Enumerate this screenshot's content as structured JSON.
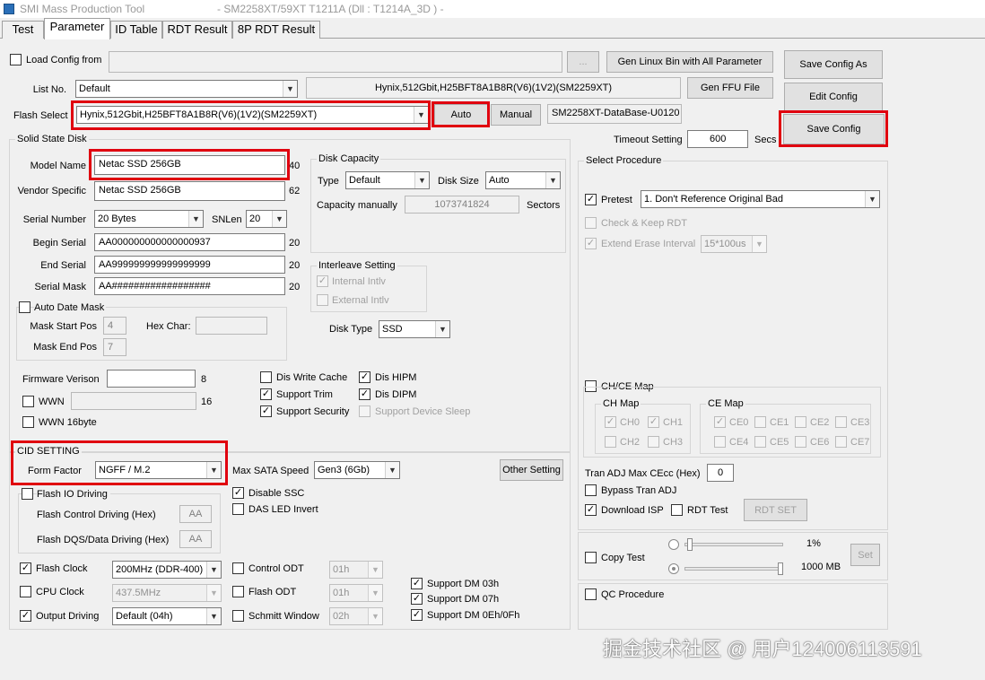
{
  "window": {
    "title": "SMI Mass Production Tool",
    "subtitle": "- SM2258XT/59XT   T1211A     (Dll : T1214A_3D ) -"
  },
  "tabs": [
    "Test",
    "Parameter",
    "ID Table",
    "RDT Result",
    "8P RDT Result"
  ],
  "top": {
    "load_config_label": "Load Config from",
    "load_config_checked": false,
    "load_config_path": "",
    "browse_label": "...",
    "gen_linux_label": "Gen Linux Bin with All Parameter",
    "gen_ffu_label": "Gen FFU File",
    "save_config_as_label": "Save Config As",
    "edit_config_label": "Edit Config",
    "save_config_label": "Save Config",
    "list_no_label": "List No.",
    "list_no_value": "Default",
    "flash_info": "Hynix,512Gbit,H25BFT8A1B8R(V6)(1V2)(SM2259XT)",
    "flash_select_label": "Flash Select",
    "flash_select_value": "Hynix,512Gbit,H25BFT8A1B8R(V6)(1V2)(SM2259XT)",
    "auto_label": "Auto",
    "manual_label": "Manual",
    "database": "SM2258XT-DataBase-U0120",
    "timeout_label": "Timeout Setting",
    "timeout_value": "600",
    "timeout_unit": "Secs"
  },
  "ssd": {
    "group_label": "Solid State Disk",
    "model_name_label": "Model Name",
    "model_name_value": "Netac SSD 256GB",
    "model_name_len": "40",
    "vendor_label": "Vendor Specific",
    "vendor_value": "Netac SSD 256GB",
    "vendor_len": "62",
    "serial_number_label": "Serial Number",
    "serial_number_value": "20 Bytes",
    "snlen_label": "SNLen",
    "snlen_value": "20",
    "begin_serial_label": "Begin Serial",
    "begin_serial_value": "AA000000000000000937",
    "begin_serial_len": "20",
    "end_serial_label": "End Serial",
    "end_serial_value": "AA999999999999999999",
    "end_serial_len": "20",
    "serial_mask_label": "Serial Mask",
    "serial_mask_value": "AA##################",
    "serial_mask_len": "20",
    "auto_date_mask_label": "Auto Date Mask",
    "auto_date_mask_checked": false,
    "mask_start_label": "Mask Start Pos",
    "mask_start_value": "4",
    "hex_char_label": "Hex Char:",
    "hex_char_value": "",
    "mask_end_label": "Mask End Pos",
    "mask_end_value": "7",
    "disk_capacity_label": "Disk Capacity",
    "type_label": "Type",
    "type_value": "Default",
    "disk_size_label": "Disk Size",
    "disk_size_value": "Auto",
    "capacity_manually_label": "Capacity manually",
    "capacity_value": "1073741824",
    "sectors_label": "Sectors",
    "interleave_label": "Interleave Setting",
    "internal_intlv_label": "Internal Intlv",
    "internal_intlv_checked": true,
    "external_intlv_label": "External Intlv",
    "external_intlv_checked": false,
    "disk_type_label": "Disk Type",
    "disk_type_value": "SSD",
    "firmware_label": "Firmware Verison",
    "firmware_value": "",
    "firmware_len": "8",
    "wwn_label": "WWN",
    "wwn_checked": false,
    "wwn_value": "",
    "wwn_len": "16",
    "wwn16_label": "WWN 16byte",
    "wwn16_checked": false,
    "dis_write_cache_label": "Dis Write Cache",
    "dis_write_cache_checked": false,
    "dis_hipm_label": "Dis HIPM",
    "dis_hipm_checked": true,
    "support_trim_label": "Support Trim",
    "support_trim_checked": true,
    "dis_dipm_label": "Dis DIPM",
    "dis_dipm_checked": true,
    "support_security_label": "Support Security",
    "support_security_checked": true,
    "support_device_sleep_label": "Support Device Sleep",
    "support_device_sleep_checked": false
  },
  "cid": {
    "group_label": "CID SETTING",
    "form_factor_label": "Form Factor",
    "form_factor_value": "NGFF / M.2",
    "max_sata_label": "Max SATA Speed",
    "max_sata_value": "Gen3 (6Gb)",
    "other_setting_label": "Other Setting",
    "flash_io_label": "Flash IO Driving",
    "flash_io_checked": false,
    "flash_control_label": "Flash Control Driving (Hex)",
    "flash_control_value": "AA",
    "flash_dqs_label": "Flash DQS/Data Driving (Hex)",
    "flash_dqs_value": "AA",
    "disable_ssc_label": "Disable SSC",
    "disable_ssc_checked": true,
    "das_led_label": "DAS LED Invert",
    "das_led_checked": false,
    "flash_clock_label": "Flash Clock",
    "flash_clock_checked": true,
    "flash_clock_value": "200MHz (DDR-400)",
    "cpu_clock_label": "CPU Clock",
    "cpu_clock_checked": false,
    "cpu_clock_value": "437.5MHz",
    "output_driving_label": "Output Driving",
    "output_driving_checked": true,
    "output_driving_value": "Default (04h)",
    "control_odt_label": "Control ODT",
    "control_odt_checked": false,
    "control_odt_value": "01h",
    "flash_odt_label": "Flash ODT",
    "flash_odt_checked": false,
    "flash_odt_value": "01h",
    "schmitt_label": "Schmitt Window",
    "schmitt_checked": false,
    "schmitt_value": "02h",
    "dm03_label": "Support DM 03h",
    "dm03_checked": true,
    "dm07_label": "Support DM 07h",
    "dm07_checked": true,
    "dm0e_label": "Support DM 0Eh/0Fh",
    "dm0e_checked": true
  },
  "proc": {
    "group_label": "Select Procedure",
    "pretest_label": "Pretest",
    "pretest_checked": true,
    "pretest_value": "1. Don't Reference Original Bad",
    "check_keep_label": "Check & Keep RDT",
    "check_keep_checked": false,
    "extend_erase_label": "Extend Erase Interval",
    "extend_erase_checked": true,
    "extend_erase_value": "15*100us",
    "chce_map_label": "CH/CE Map",
    "chce_map_checked": false,
    "ch_map_label": "CH Map",
    "ch_items": [
      {
        "label": "CH0",
        "checked": true
      },
      {
        "label": "CH1",
        "checked": true
      },
      {
        "label": "CH2",
        "checked": false
      },
      {
        "label": "CH3",
        "checked": false
      }
    ],
    "ce_map_label": "CE Map",
    "ce_items": [
      {
        "label": "CE0",
        "checked": true
      },
      {
        "label": "CE1",
        "checked": false
      },
      {
        "label": "CE2",
        "checked": false
      },
      {
        "label": "CE3",
        "checked": false
      },
      {
        "label": "CE4",
        "checked": false
      },
      {
        "label": "CE5",
        "checked": false
      },
      {
        "label": "CE6",
        "checked": false
      },
      {
        "label": "CE7",
        "checked": false
      }
    ],
    "tran_adj_label": "Tran ADJ Max CEcc (Hex)",
    "tran_adj_value": "0",
    "bypass_label": "Bypass Tran ADJ",
    "bypass_checked": false,
    "download_isp_label": "Download ISP",
    "download_isp_checked": true,
    "rdt_test_label": "RDT Test",
    "rdt_test_checked": false,
    "rdt_set_label": "RDT SET",
    "copy_test_label": "Copy Test",
    "copy_test_checked": false,
    "pct_value": "1%",
    "mb_value": "1000 MB",
    "set_label": "Set",
    "pct_slider_fraction": 0.03,
    "mb_slider_fraction": 1.0,
    "qc_label": "QC Procedure",
    "qc_checked": false
  },
  "watermark": "掘金技术社区 @ 用户124006113591"
}
